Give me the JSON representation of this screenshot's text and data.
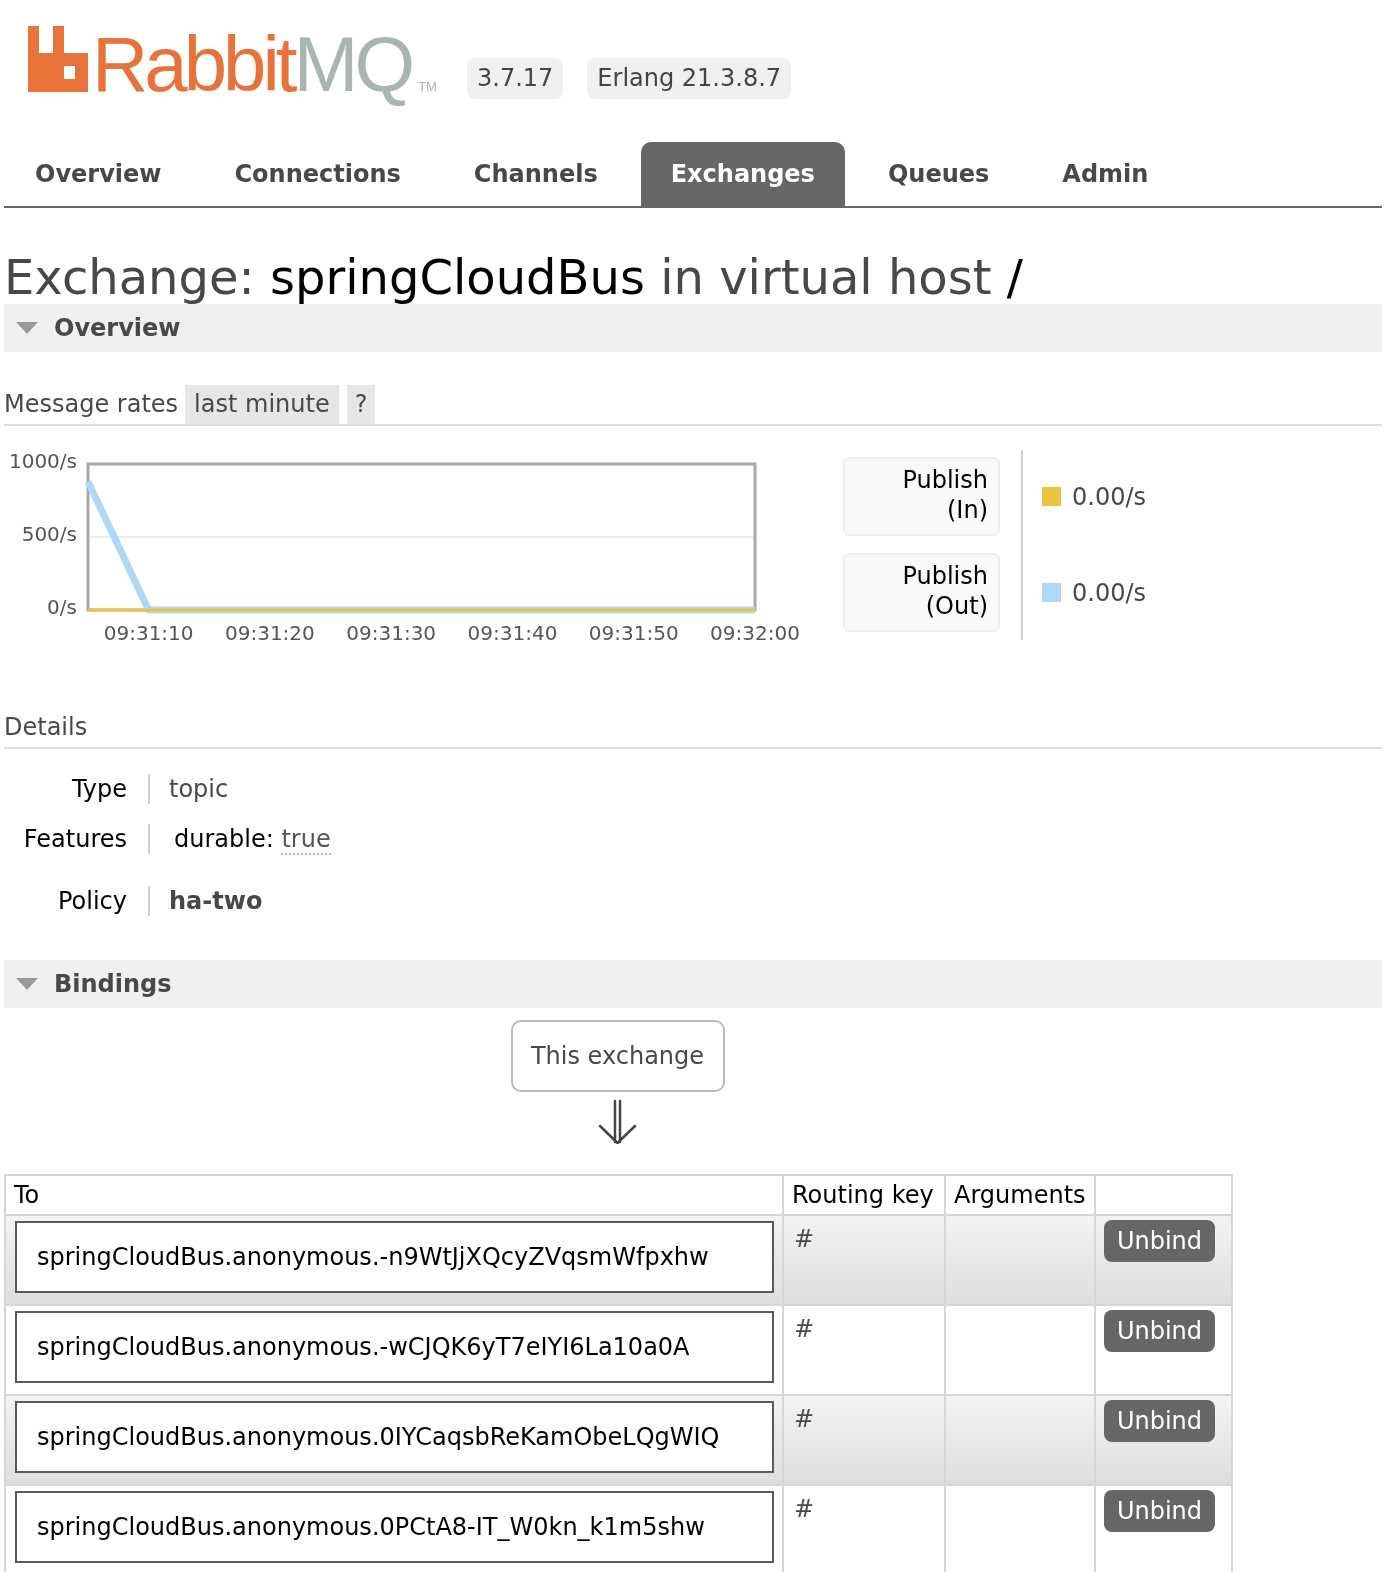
{
  "header": {
    "logo": {
      "part_1": "Rabbit",
      "part_2": "MQ",
      "trademark": "TM"
    },
    "badges": [
      "3.7.17",
      "Erlang 21.3.8.7"
    ]
  },
  "tabs": [
    {
      "label": "Overview",
      "selected": false
    },
    {
      "label": "Connections",
      "selected": false
    },
    {
      "label": "Channels",
      "selected": false
    },
    {
      "label": "Exchanges",
      "selected": true
    },
    {
      "label": "Queues",
      "selected": false
    },
    {
      "label": "Admin",
      "selected": false
    }
  ],
  "title": {
    "prefix": "Exchange:",
    "name": "springCloudBus",
    "middle": "in virtual host",
    "vhost": "/"
  },
  "overview": {
    "title": "Overview",
    "expanded": true,
    "message_rates": {
      "label": "Message rates",
      "range": "last minute",
      "help": "?",
      "chart_data": {
        "type": "line",
        "categories": [
          null,
          "09:31:10",
          null,
          "09:31:20",
          null,
          "09:31:30",
          null,
          "09:31:40",
          null,
          "09:31:50",
          null,
          "09:32:00"
        ],
        "ylim": [
          0,
          1000
        ],
        "yticks": [
          {
            "value": 0,
            "label": "0/s"
          },
          {
            "value": 500,
            "label": "500/s"
          },
          {
            "value": 1000,
            "label": "1000/s"
          }
        ],
        "series": [
          {
            "name": "Publish (In)",
            "color": "#edc240",
            "values": [
              0,
              0,
              0,
              0,
              0,
              0,
              0,
              0,
              0,
              0,
              0,
              0
            ]
          },
          {
            "name": "Publish (Out)",
            "color": "#afd8f8",
            "values": [
              880,
              0,
              0,
              0,
              0,
              0,
              0,
              0,
              0,
              0,
              0,
              0
            ]
          }
        ]
      },
      "rates": [
        "0.00/s",
        "0.00/s"
      ]
    },
    "details": {
      "title": "Details",
      "rows": [
        {
          "kind": "text",
          "label": "Type",
          "value": "topic"
        },
        {
          "kind": "feature",
          "label": "Features",
          "key": "durable:",
          "value": "true"
        },
        {
          "kind": "policy",
          "label": "Policy",
          "value": "ha-two"
        }
      ]
    }
  },
  "bindings": {
    "title": "Bindings",
    "expanded": true,
    "source": "This exchange",
    "columns": [
      "To",
      "Routing key",
      "Arguments"
    ],
    "rows": [
      {
        "destination": "springCloudBus.anonymous.-n9WtJjXQcyZVqsmWfpxhw",
        "routing_key": "#",
        "action": "Unbind"
      },
      {
        "destination": "springCloudBus.anonymous.-wCJQK6yT7eIYI6La10a0A",
        "routing_key": "#",
        "action": "Unbind"
      },
      {
        "destination": "springCloudBus.anonymous.0IYCaqsbReKamObeLQgWIQ",
        "routing_key": "#",
        "action": "Unbind"
      },
      {
        "destination": "springCloudBus.anonymous.0PCtA8-IT_W0kn_k1m5shw",
        "routing_key": "#",
        "action": "Unbind"
      }
    ]
  }
}
